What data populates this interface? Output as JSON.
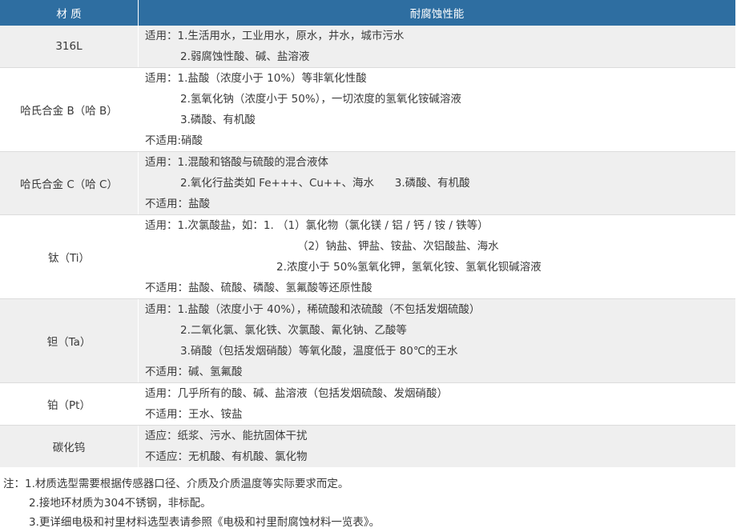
{
  "table": {
    "headers": [
      "材 质",
      "耐腐蚀性能"
    ],
    "rows": [
      {
        "material": "316L",
        "lines": [
          "适用：1.生活用水，工业用水，原水，井水，城市污水",
          "2.弱腐蚀性酸、碱、盐溶液"
        ]
      },
      {
        "material": "哈氏合金 B（哈 B）",
        "lines": [
          "适用：1.盐酸（浓度小于 10%）等非氧化性酸",
          "2.氢氧化钠（浓度小于 50%），一切浓度的氢氧化铵碱溶液",
          "3.磷酸、有机酸",
          "不适用:硝酸"
        ]
      },
      {
        "material": "哈氏合金 C（哈 C）",
        "lines": [
          "适用：1.混酸和铬酸与硫酸的混合液体",
          "2.氧化行盐类如 Fe+++、Cu++、海水      3.磷酸、有机酸",
          "不适用：盐酸"
        ]
      },
      {
        "material": "钛（Ti）",
        "lines": [
          "适用：1.次氯酸盐，如：1. （1）氯化物（氯化镁 / 铝 / 钙 / 铵 / 铁等）",
          "（2）钠盐、钾盐、铵盐、次铝酸盐、海水",
          "2.浓度小于 50%氢氧化钾，氢氧化铵、氢氧化钡碱溶液",
          "不适用：盐酸、硫酸、磷酸、氢氟酸等还原性酸"
        ]
      },
      {
        "material": "钽（Ta）",
        "lines": [
          "适用：1.盐酸（浓度小于 40%），稀硫酸和浓硫酸（不包括发烟硫酸）",
          "2.二氧化氯、氯化铁、次氯酸、氰化钠、乙酸等",
          "3.硝酸（包括发烟硝酸）等氧化酸，温度低于 80℃的王水",
          "不适用：碱、氢氟酸"
        ]
      },
      {
        "material": "铂（Pt）",
        "lines": [
          "适用：几乎所有的酸、碱、盐溶液（包括发烟硫酸、发烟硝酸）",
          "不适用：王水、铵盐"
        ]
      },
      {
        "material": "碳化钨",
        "lines": [
          "适应：纸浆、污水、能抗固体干扰",
          "不适应：无机酸、有机酸、氯化物"
        ]
      }
    ]
  },
  "notes": [
    "注：1.材质选型需要根据传感器口径、介质及介质温度等实际要求而定。",
    "2.接地环材质为304不锈钢，非标配。",
    "3.更详细电极和衬里材料选型表请参照《电极和衬里耐腐蚀材料一览表》。"
  ],
  "colors": {
    "header_bg": "#2e6ea1",
    "row_alt": "#efefef",
    "text": "#3a3a3a"
  }
}
